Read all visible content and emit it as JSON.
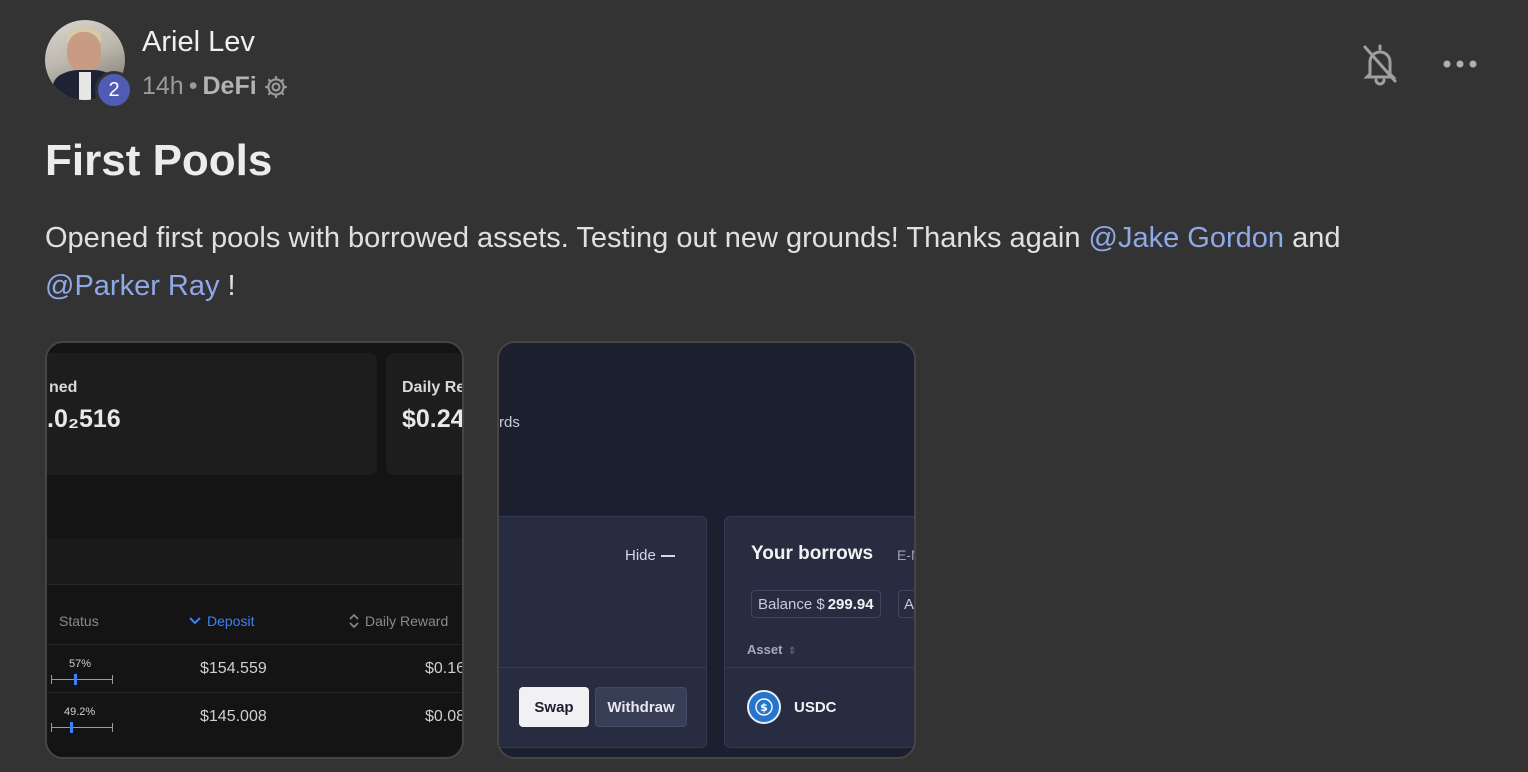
{
  "post": {
    "author": "Ariel Lev",
    "level": "2",
    "time": "14h",
    "separator": "•",
    "community": "DeFi",
    "title": "First Pools",
    "body_parts": {
      "text1": "Opened first pools with borrowed assets. Testing out new grounds! Thanks again ",
      "mention1": "@Jake Gordon",
      "text2": " and ",
      "mention2": "@Parker Ray",
      "text3": " !"
    }
  },
  "image1": {
    "box1_label": "ned",
    "box1_value": ".0₂516",
    "box2_label": "Daily Re",
    "box2_value": "$0.24",
    "columns": [
      "Status",
      "Deposit",
      "Daily Reward"
    ],
    "rows": [
      {
        "pct": "57%",
        "level": 0.57,
        "deposit": "$154.559",
        "reward": "$0.16"
      },
      {
        "pct": "49.2%",
        "level": 0.492,
        "deposit": "$145.008",
        "reward": "$0.08"
      }
    ]
  },
  "image2": {
    "rewards_fragment": "rds",
    "hide_label": "Hide",
    "swap_label": "Swap",
    "withdraw_label": "Withdraw",
    "borrows_title": "Your borrows",
    "emode_fragment": "E-M",
    "balance_label": "Balance $",
    "balance_value": "299.94",
    "al_fragment": "Al",
    "asset_header": "Asset",
    "asset_name": "USDC"
  },
  "colors": {
    "background": "#333333",
    "mention": "#8fa8e8",
    "level_badge": "#4f5bb5",
    "deposit_active": "#3b82f6",
    "usdc": "#2775ca"
  },
  "icons": [
    "bell-off-icon",
    "more-horizontal-icon",
    "gear-icon",
    "chevron-down-icon",
    "sort-icon",
    "usdc-icon"
  ]
}
